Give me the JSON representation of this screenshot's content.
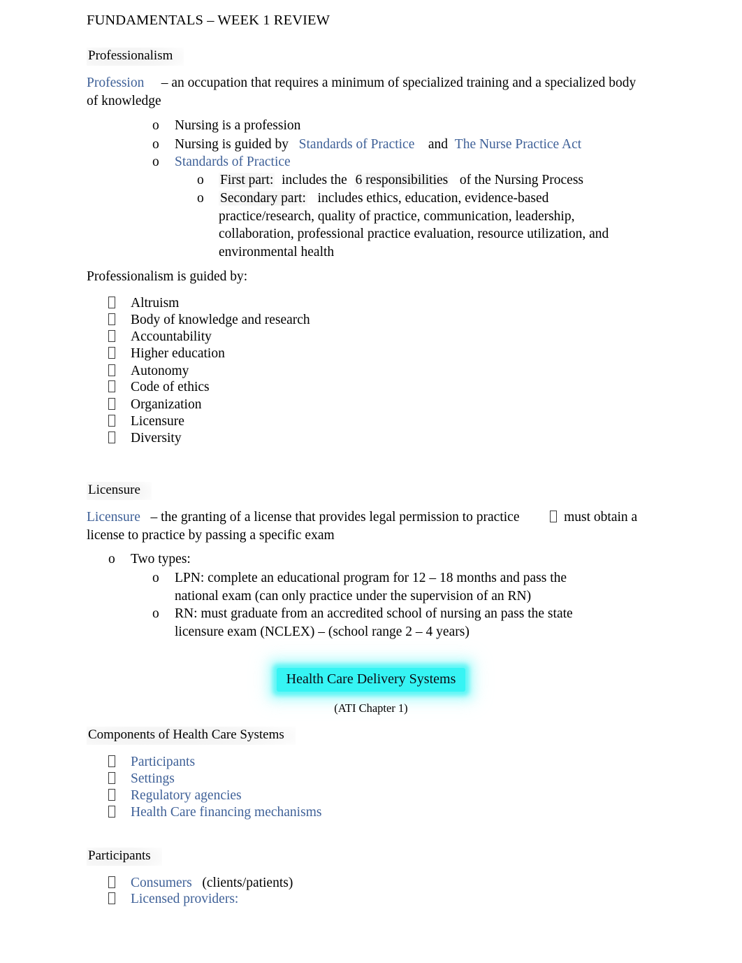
{
  "document": {
    "title": "FUNDAMENTALS – WEEK 1 REVIEW"
  },
  "colors": {
    "link_blue": "#3f6198",
    "highlight_cyan": "#36f4f4",
    "text_black": "#000000"
  },
  "icons": {
    "tofu_bullet": "missing-glyph-box"
  },
  "sections": {
    "professionalism": {
      "heading": "Professionalism",
      "definition_term": "Profession",
      "definition_text": "– an occupation that requires a minimum of specialized training and a specialized body of knowledge",
      "bullets": {
        "b1": "Nursing is a profession",
        "b2_pre": "Nursing is guided by",
        "b2_link1": "Standards of Practice",
        "b2_mid": "and",
        "b2_link2": "The Nurse Practice Act",
        "b3_link": "Standards of Practice",
        "b3_sub1_label": "First part:",
        "b3_sub1_mid": "includes the",
        "b3_sub1_emph": "6 responsibilities",
        "b3_sub1_end": "of the Nursing Process",
        "b3_sub2_label": "Secondary part:",
        "b3_sub2_text": "includes ethics, education, evidence-based practice/research, quality of practice, communication, leadership, collaboration, professional practice evaluation, resource utilization, and environmental health"
      },
      "guided_by_label": "Professionalism is guided by:",
      "guided_by_items": [
        "Altruism",
        "Body of knowledge and research",
        "Accountability",
        "Higher education",
        "Autonomy",
        "Code of ethics",
        "Organization",
        "Licensure",
        "Diversity"
      ]
    },
    "licensure": {
      "heading": "Licensure",
      "definition_term": "Licensure",
      "definition_text_1": "– the granting of a license that provides legal permission to practice",
      "definition_text_2": "must",
      "definition_text_3": "obtain a license to practice by passing a specific exam",
      "two_types_label": "Two types:",
      "types": [
        "LPN:  complete an educational program for 12 – 18 months and pass the national exam (can only practice under the supervision of an RN)",
        "RN:  must graduate from an accredited school of nursing an pass the state licensure exam (NCLEX) – (school range 2 – 4 years)"
      ]
    },
    "health_care_delivery": {
      "banner_heading": "Health Care Delivery Systems",
      "sub_note": "(ATI Chapter 1)",
      "components_heading": "Components of Health Care Systems",
      "components_items": [
        "Participants",
        "Settings",
        "Regulatory agencies",
        "Health Care financing mechanisms"
      ],
      "participants_heading": "Participants",
      "participants_items": [
        {
          "link": "Consumers",
          "plain": "(clients/patients)"
        },
        {
          "link": "Licensed providers:",
          "plain": ""
        }
      ]
    }
  }
}
